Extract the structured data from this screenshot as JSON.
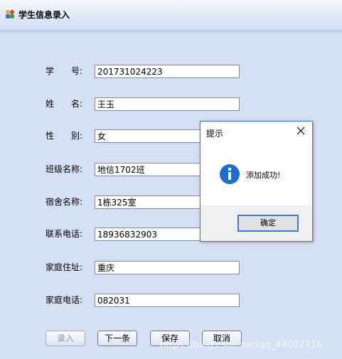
{
  "window": {
    "title": "学生信息录入",
    "icon": "app-people-icon"
  },
  "form": {
    "fields": [
      {
        "label": "学　　号:",
        "value": "201731024223"
      },
      {
        "label": "姓　　名:",
        "value": "王玉"
      },
      {
        "label": "性　　别:",
        "value": "女"
      },
      {
        "label": "班级名称:",
        "value": "地信1702班"
      },
      {
        "label": "宿舍名称:",
        "value": "1栋325室"
      },
      {
        "label": "联系电话:",
        "value": "18936832903"
      },
      {
        "label": "家庭住址:",
        "value": "重庆"
      },
      {
        "label": "家庭电话:",
        "value": "082031"
      }
    ]
  },
  "buttons": {
    "enter": "录入",
    "next": "下一条",
    "save": "保存",
    "cancel": "取消"
  },
  "dialog": {
    "title": "提示",
    "message": "添加成功!",
    "ok": "确定",
    "icon": "info-icon"
  },
  "watermark": "https://blog.csdn.net/qq_44002716",
  "colors": {
    "background": "#d6e0f5",
    "dialog_border": "#3c7fd6",
    "info_blue": "#1a6fd0"
  }
}
